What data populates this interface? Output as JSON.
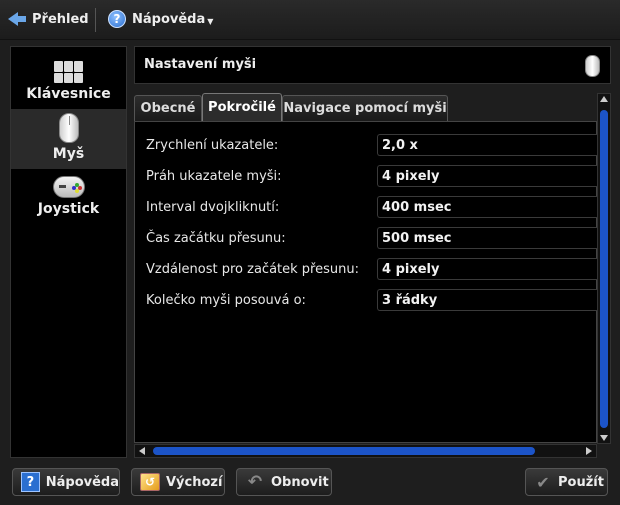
{
  "toolbar": {
    "back_label": "Přehled",
    "help_label": "Nápověda"
  },
  "sidebar": {
    "items": [
      {
        "label": "Klávesnice",
        "icon": "keyboard-icon"
      },
      {
        "label": "Myš",
        "icon": "mouse-icon",
        "selected": true
      },
      {
        "label": "Joystick",
        "icon": "gamepad-icon"
      }
    ]
  },
  "header": {
    "title": "Nastavení myši"
  },
  "tabs": [
    {
      "label": "Obecné",
      "active": false
    },
    {
      "label": "Pokročilé",
      "active": true
    },
    {
      "label": "Navigace pomocí myši",
      "active": false
    }
  ],
  "settings": [
    {
      "label": "Zrychlení ukazatele:",
      "value": "2,0 x"
    },
    {
      "label": "Práh ukazatele myši:",
      "value": "4 pixely"
    },
    {
      "label": "Interval dvojkliknutí:",
      "value": "400 msec"
    },
    {
      "label": "Čas začátku přesunu:",
      "value": "500 msec"
    },
    {
      "label": "Vzdálenost pro začátek přesunu:",
      "value": "4 pixely"
    },
    {
      "label": "Kolečko myši posouvá o:",
      "value": "3 řádky"
    }
  ],
  "buttons": {
    "help": "Nápověda",
    "default": "Výchozí",
    "reset": "Obnovit",
    "apply": "Použít"
  },
  "colors": {
    "accent": "#1c54c8",
    "background": "#000000"
  }
}
